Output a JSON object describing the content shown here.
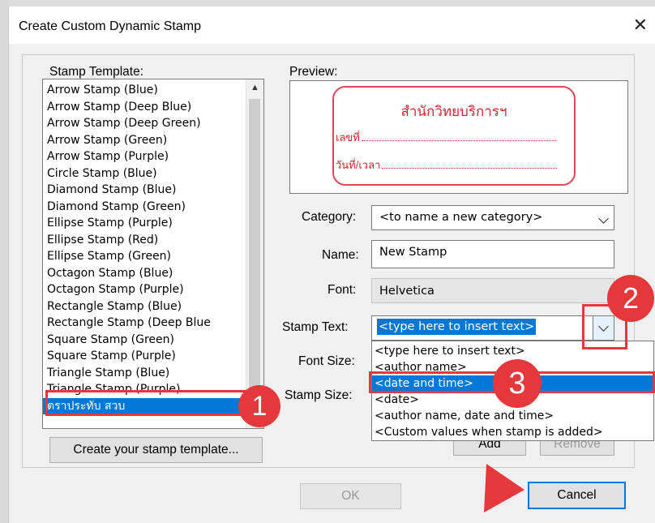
{
  "dialog": {
    "title": "Create Custom Dynamic Stamp"
  },
  "template_section": {
    "label": "Stamp Template:",
    "items": [
      "Arrow Stamp (Blue)",
      "Arrow Stamp (Deep Blue)",
      "Arrow Stamp (Deep Green)",
      "Arrow Stamp (Green)",
      "Arrow Stamp (Purple)",
      "Circle Stamp (Blue)",
      "Diamond Stamp (Blue)",
      "Diamond Stamp (Green)",
      "Ellipse Stamp (Purple)",
      "Ellipse Stamp (Red)",
      "Ellipse Stamp (Green)",
      "Octagon Stamp (Blue)",
      "Octagon Stamp (Purple)",
      "Rectangle Stamp (Blue)",
      "Rectangle Stamp (Deep Blue",
      "Square Stamp (Green)",
      "Square Stamp (Purple)",
      "Triangle Stamp (Blue)",
      "Triangle Stamp (Purple)",
      "ตราประทับ สวบ"
    ],
    "selected_item": "ตราประทับ สวบ",
    "create_button": "Create your stamp template..."
  },
  "preview": {
    "label": "Preview:",
    "stamp_title": "สำนักวิทยบริการฯ",
    "line1_label": "เลขที่",
    "line2_label": "วันที่/เวลา"
  },
  "form": {
    "category_label": "Category:",
    "category_value": "<to name a new category>",
    "name_label": "Name:",
    "name_value": "New Stamp",
    "font_label": "Font:",
    "font_value": "Helvetica",
    "stamp_text_label": "Stamp Text:",
    "stamp_text_value": "<type here to insert text>",
    "font_size_label": "Font Size:",
    "stamp_size_label": "Stamp Size:",
    "add_button": "Add",
    "remove_button": "Remove"
  },
  "stamp_text_dropdown": {
    "options": [
      "<type here to insert text>",
      "<author name>",
      "<date and time>",
      "<date>",
      "<author name, date and time>",
      "<Custom values when stamp is added>"
    ],
    "highlighted": "<date and time>"
  },
  "footer": {
    "ok_button": "OK",
    "cancel_button": "Cancel"
  },
  "callouts": [
    "1",
    "2",
    "3"
  ],
  "colors": {
    "accent": "#0078d7",
    "callout": "#e5383b",
    "stamp": "#d0262f"
  }
}
